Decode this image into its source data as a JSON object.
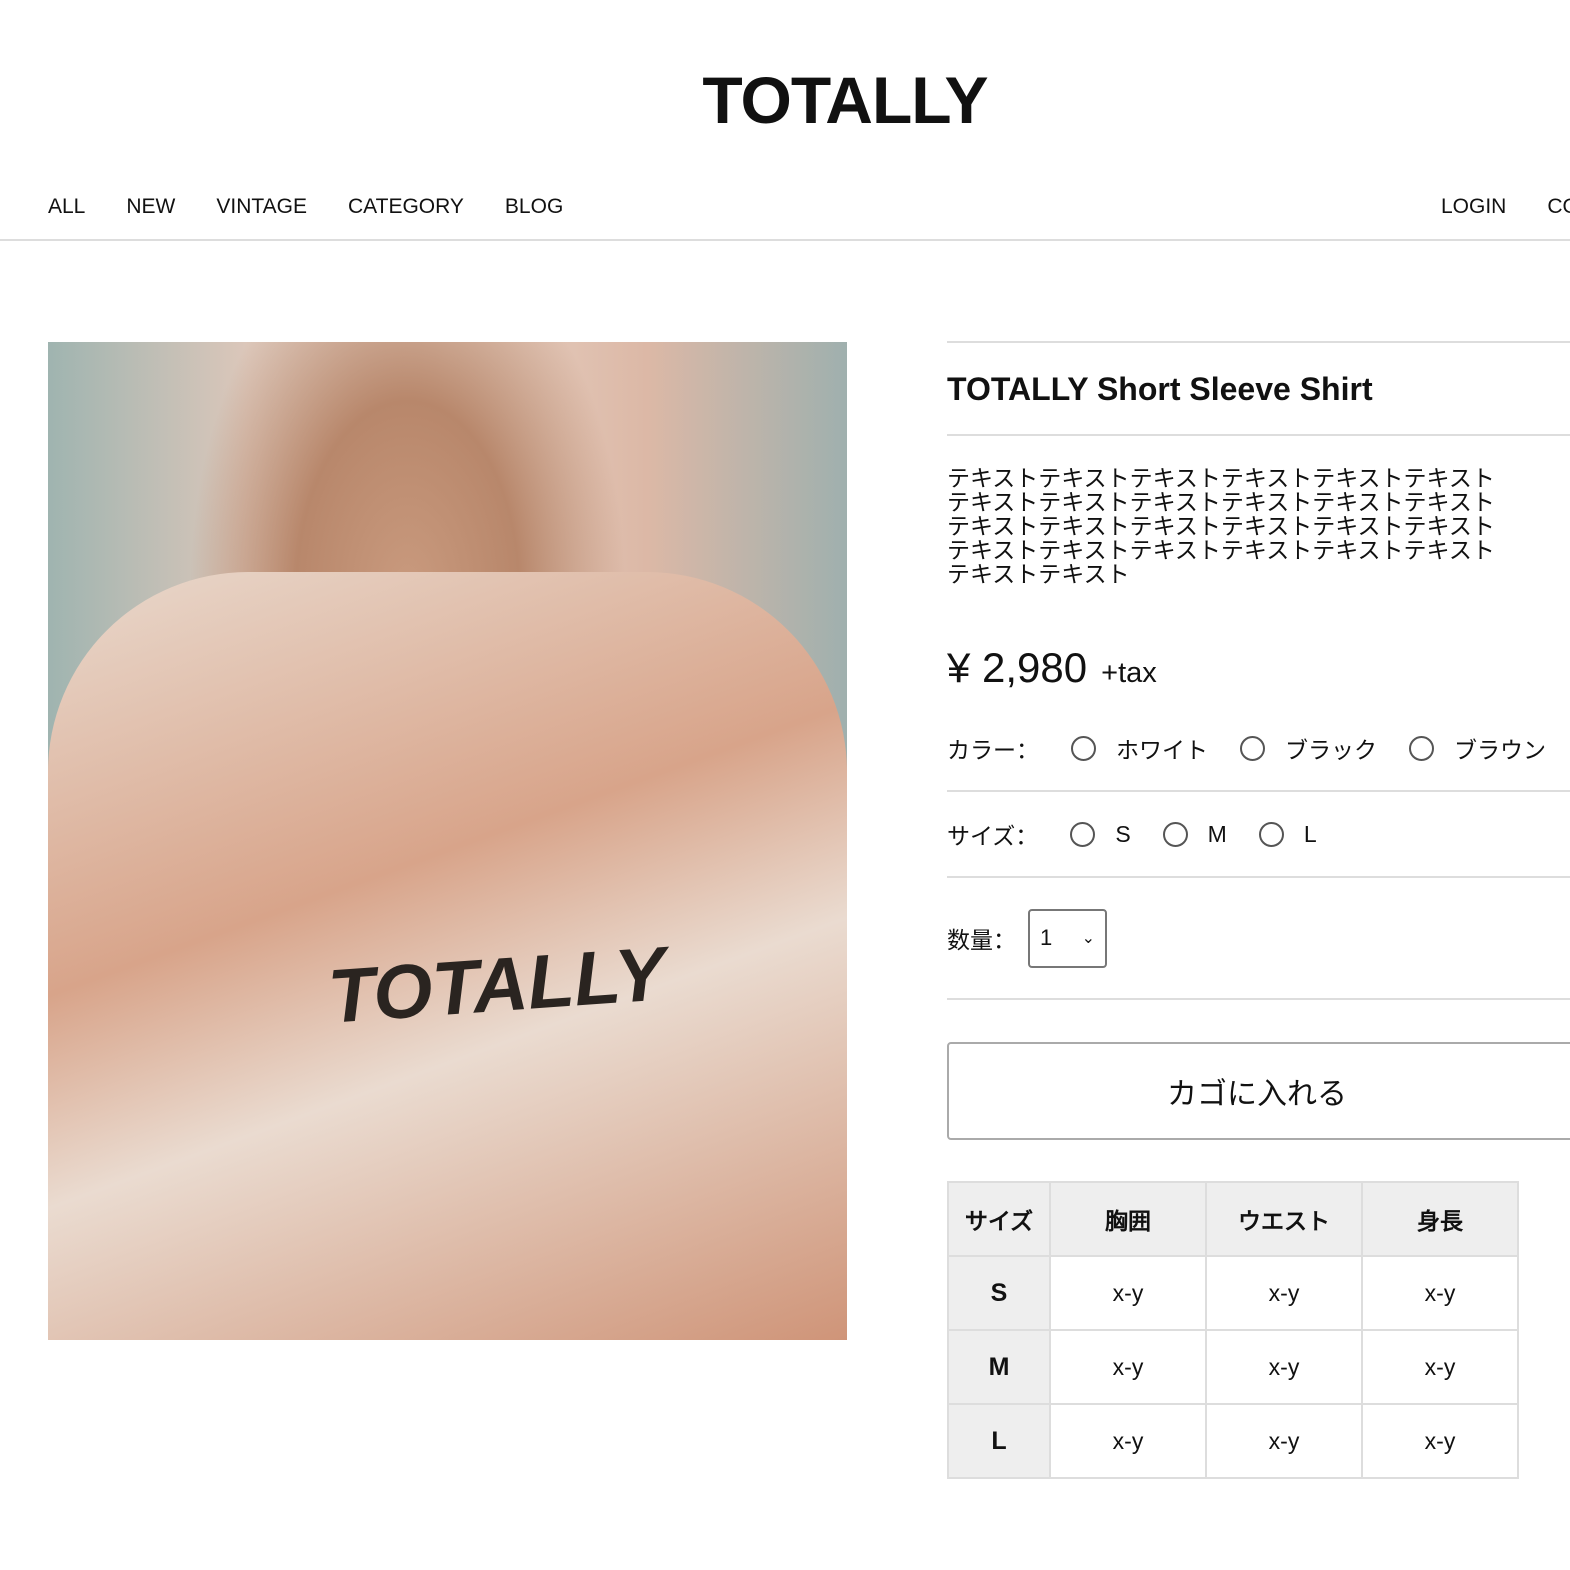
{
  "header": {
    "logo": "TOTALLY",
    "nav": [
      "ALL",
      "NEW",
      "VINTAGE",
      "CATEGORY",
      "BLOG"
    ],
    "nav_right": [
      "LOGIN",
      "CO"
    ]
  },
  "product": {
    "image_print": "TOTALLY",
    "title": "TOTALLY Short Sleeve Shirt",
    "description": "テキストテキストテキストテキストテキストテキストテキストテキストテキストテキストテキストテキストテキストテキストテキストテキストテキストテキストテキストテキストテキストテキストテキストテキストテキストテキスト",
    "price": "¥ 2,980",
    "tax": "+tax",
    "color_label": "カラー：",
    "colors": [
      "ホワイト",
      "ブラック",
      "ブラウン"
    ],
    "size_label": "サイズ：",
    "sizes": [
      "S",
      "M",
      "L"
    ],
    "qty_label": "数量：",
    "qty_value": "1",
    "cart_button": "カゴに入れる"
  },
  "size_table": {
    "headers": [
      "サイズ",
      "胸囲",
      "ウエスト",
      "身長"
    ],
    "rows": [
      [
        "S",
        "x-y",
        "x-y",
        "x-y"
      ],
      [
        "M",
        "x-y",
        "x-y",
        "x-y"
      ],
      [
        "L",
        "x-y",
        "x-y",
        "x-y"
      ]
    ]
  }
}
